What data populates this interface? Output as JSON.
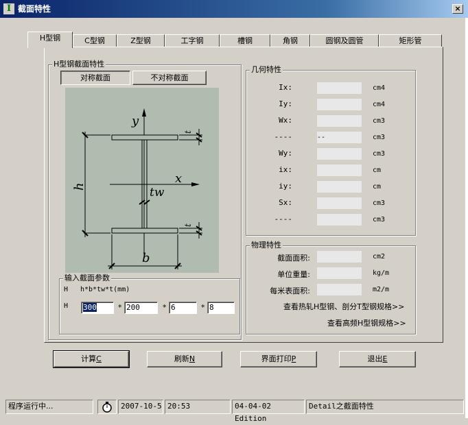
{
  "window": {
    "title": "截面特性",
    "app_icon": "I",
    "close_glyph": "×"
  },
  "tabs": [
    {
      "label": "H型钢",
      "active": true
    },
    {
      "label": "C型钢"
    },
    {
      "label": "Z型钢"
    },
    {
      "label": "工字钢"
    },
    {
      "label": "槽钢"
    },
    {
      "label": "角钢"
    },
    {
      "label": "圆钢及圆管"
    },
    {
      "label": "矩形管"
    }
  ],
  "section_group": {
    "title": "H型钢截面特性",
    "sym_button": "对称截面",
    "asym_button": "不对称截面",
    "diagram": {
      "y_label": "y",
      "x_label": "x",
      "h_label": "h",
      "b_label": "b",
      "tw_label": "tw",
      "t_label": "t",
      "bg": "#b0bcb0"
    }
  },
  "input_group": {
    "title": "输入截面参数",
    "row1_key": "H",
    "formula": "h*b*tw*t(mm)",
    "row2_key": "H",
    "h_value": "300",
    "b_value": "200",
    "tw_value": "6",
    "t_value": "8",
    "sep": "*"
  },
  "geo_group": {
    "title": "几何特性",
    "rows": [
      {
        "label": "Ix:",
        "unit": "cm4"
      },
      {
        "label": "Iy:",
        "unit": "cm4"
      },
      {
        "label": "Wx:",
        "unit": "cm3"
      },
      {
        "label": "----",
        "unit": "cm3",
        "field_text": "--"
      },
      {
        "label": "Wy:",
        "unit": "cm3"
      },
      {
        "label": "ix:",
        "unit": "cm"
      },
      {
        "label": "iy:",
        "unit": "cm"
      },
      {
        "label": "Sx:",
        "unit": "cm3"
      },
      {
        "label": "----",
        "unit": "cm3"
      }
    ]
  },
  "phys_group": {
    "title": "物理特性",
    "rows": [
      {
        "label": "截面面积:",
        "unit": "cm2"
      },
      {
        "label": "单位重量:",
        "unit": "kg/m"
      },
      {
        "label": "每米表面积:",
        "unit": "m2/m"
      }
    ],
    "link1": "查看热轧H型钢、剖分T型钢规格>>",
    "link2": "查看高频H型钢规格>>"
  },
  "actions": {
    "calc": "计算",
    "calc_key": "C",
    "refresh": "刷新",
    "refresh_key": "N",
    "print": "界面打印",
    "print_key": "P",
    "exit": "退出",
    "exit_key": "E"
  },
  "statusbar": {
    "status": "程序运行中...",
    "date": "2007-10-5",
    "time": "20:53",
    "edition": "04-04-02 Edition",
    "detail": "Detail之截面特性"
  }
}
